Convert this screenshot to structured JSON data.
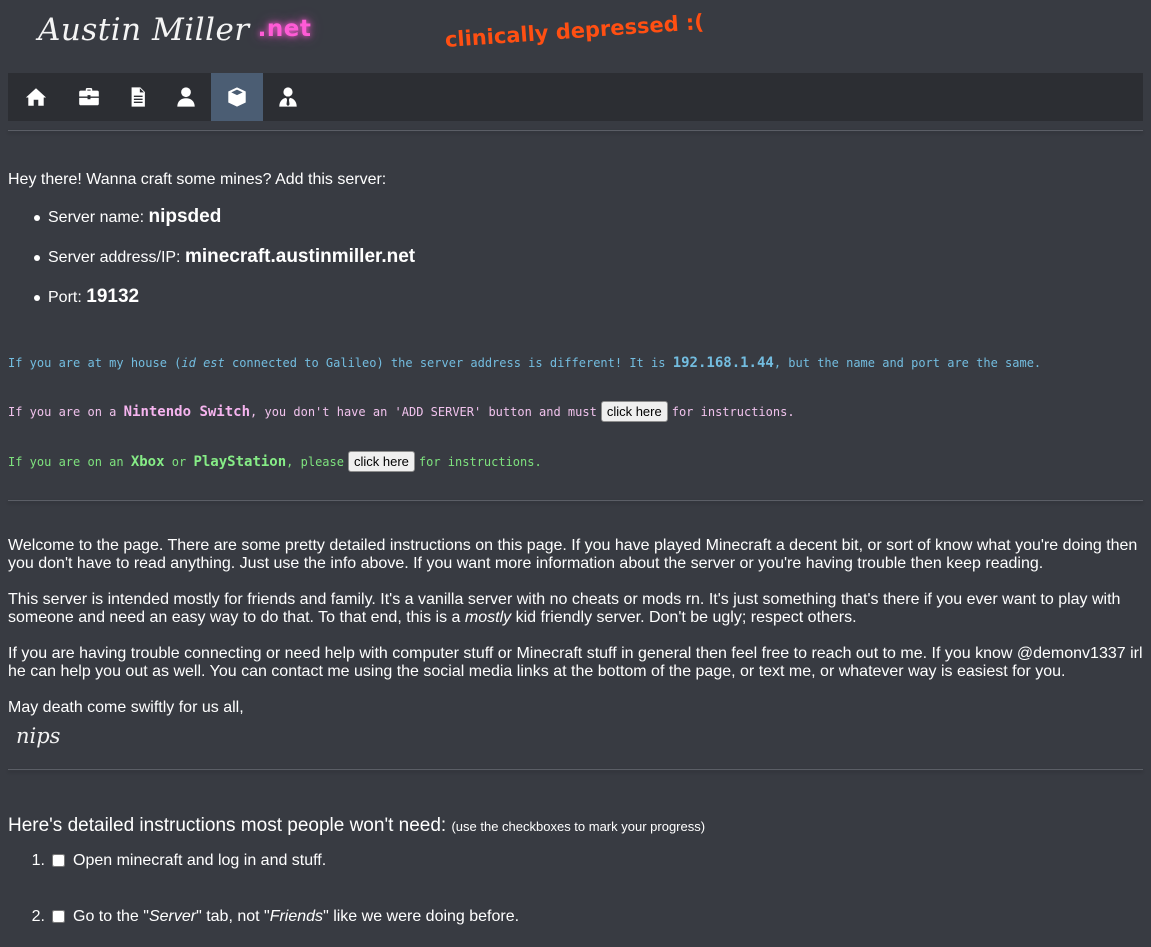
{
  "header": {
    "logo_text": "Austin Miller",
    "logo_tld": ".net",
    "tagline": "clinically depressed :("
  },
  "nav": {
    "items": [
      {
        "icon": "home-icon",
        "active": false
      },
      {
        "icon": "briefcase-icon",
        "active": false
      },
      {
        "icon": "document-icon",
        "active": false
      },
      {
        "icon": "user-icon",
        "active": false
      },
      {
        "icon": "cube-icon",
        "active": true
      },
      {
        "icon": "user-tie-icon",
        "active": false
      }
    ]
  },
  "server": {
    "intro": "Hey there! Wanna craft some mines? Add this server:",
    "name_label": "Server name:",
    "name_value": "nipsded",
    "address_label": "Server address/IP:",
    "address_value": "minecraft.austinmiller.net",
    "port_label": "Port:",
    "port_value": "19132"
  },
  "notes": {
    "house": {
      "pre": "If you are at my house (",
      "italic": "id est",
      "mid": " connected to Galileo) the server address is different! It is ",
      "ip": "192.168.1.44",
      "post": ", but the name and port are the same."
    },
    "switch": {
      "pre": "If you are on a ",
      "platform": "Nintendo Switch",
      "mid": ", you don't have an 'ADD SERVER' button and must",
      "button": "click here",
      "post": "for instructions."
    },
    "console": {
      "pre": "If you are on an ",
      "platform1": "Xbox",
      "or": " or ",
      "platform2": "PlayStation",
      "mid": ", please",
      "button": "click here",
      "post": "for instructions."
    }
  },
  "welcome": {
    "p1": "Welcome to the page. There are some pretty detailed instructions on this page. If you have played Minecraft a decent bit, or sort of know what you're doing then you don't have to read anything. Just use the info above. If you want more information about the server or you're having trouble then keep reading.",
    "p2_pre": "This server is intended mostly for friends and family. It's a vanilla server with no cheats or mods rn. It's just something that's there if you ever want to play with someone and need an easy way to do that. To that end, this is a ",
    "p2_em": "mostly",
    "p2_post": " kid friendly server. Don't be ugly; respect others.",
    "p3": "If you are having trouble connecting or need help with computer stuff or Minecraft stuff in general then feel free to reach out to me. If you know @demonv1337 irl he can help you out as well. You can contact me using the social media links at the bottom of the page, or text me, or whatever way is easiest for you.",
    "closing": "May death come swiftly for us all,",
    "signature": "nips"
  },
  "instructions": {
    "heading": "Here's detailed instructions most people won't need:",
    "subheading": "(use the checkboxes to mark your progress)",
    "steps": [
      {
        "num": "1.",
        "text": "Open minecraft and log in and stuff."
      },
      {
        "num": "2.",
        "pre": "Go to the \"",
        "em1": "Server",
        "mid": "\" tab, not \"",
        "em2": "Friends",
        "post": "\" like we were doing before."
      }
    ]
  }
}
